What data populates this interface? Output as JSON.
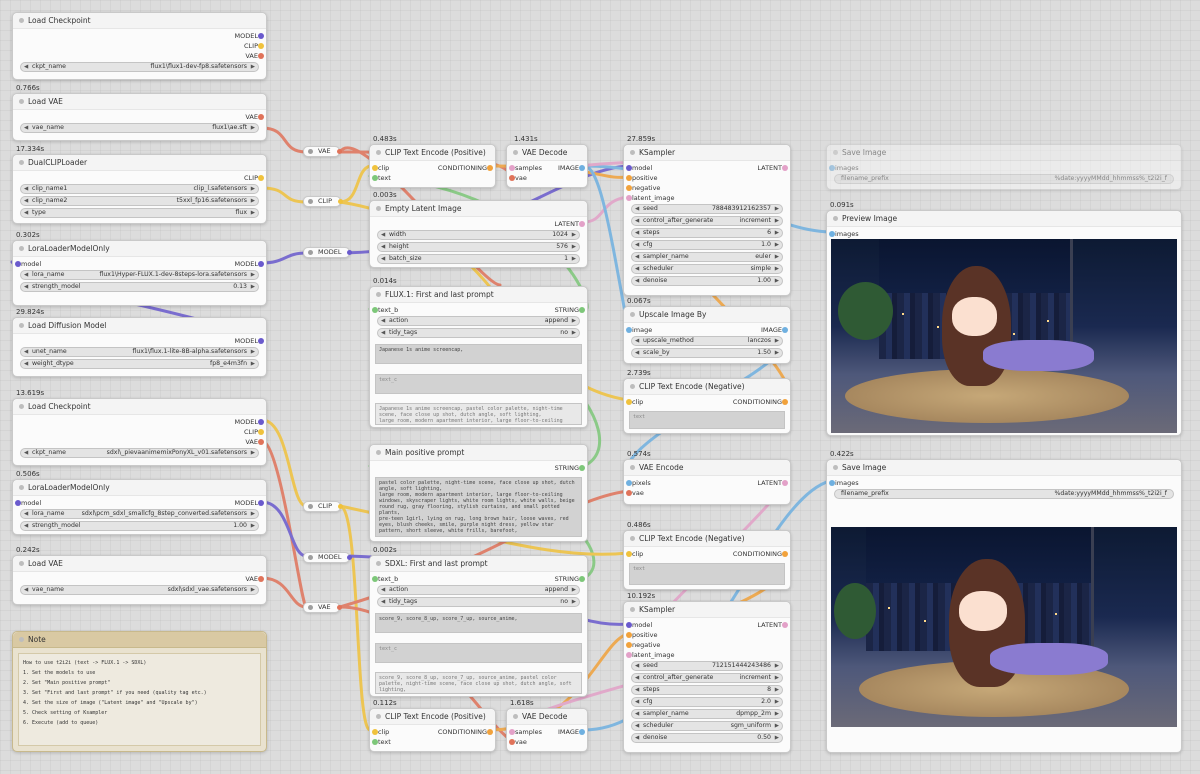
{
  "colors": {
    "model": "#6a5acd",
    "clip": "#f0c23c",
    "vae": "#e0735a",
    "conditioning": "#f1a23c",
    "latent": "#e3a1c8",
    "image": "#6fb0e0",
    "string": "#7dc779",
    "canvas": "#dcdcdc"
  },
  "nodes": {
    "load_checkpoint_1": {
      "title": "Load Checkpoint",
      "outputs": [
        "MODEL",
        "CLIP",
        "VAE"
      ],
      "ckpt_label": "ckpt_name",
      "ckpt_value": "flux1\\flux1-dev-fp8.safetensors"
    },
    "load_vae_1": {
      "timing": "0.766s",
      "title": "Load VAE",
      "output": "VAE",
      "label": "vae_name",
      "value": "flux1\\ae.sft"
    },
    "dual_clip": {
      "timing": "17.334s",
      "title": "DualCLIPLoader",
      "output": "CLIP",
      "clip1_label": "clip_name1",
      "clip1_value": "clip_l.safetensors",
      "clip2_label": "clip_name2",
      "clip2_value": "t5xxl_fp16.safetensors",
      "type_label": "type",
      "type_value": "flux"
    },
    "lora_flux": {
      "timing": "0.302s",
      "title": "LoraLoaderModelOnly",
      "input": "model",
      "output": "MODEL",
      "lora_label": "lora_name",
      "lora_value": "flux1\\Hyper-FLUX.1-dev-8steps-lora.safetensors",
      "strength_label": "strength_model",
      "strength_value": "0.13"
    },
    "load_diffusion": {
      "timing": "29.824s",
      "title": "Load Diffusion Model",
      "output": "MODEL",
      "unet_label": "unet_name",
      "unet_value": "flux1\\flux.1-lite-8B-alpha.safetensors",
      "dtype_label": "weight_dtype",
      "dtype_value": "fp8_e4m3fn"
    },
    "load_checkpoint_2": {
      "timing": "13.619s",
      "title": "Load Checkpoint",
      "outputs": [
        "MODEL",
        "CLIP",
        "VAE"
      ],
      "ckpt_label": "ckpt_name",
      "ckpt_value": "sdxl\\_pievaanimemixPonyXL_v01.safetensors"
    },
    "lora_sdxl": {
      "timing": "0.506s",
      "title": "LoraLoaderModelOnly",
      "input": "model",
      "output": "MODEL",
      "lora_label": "lora_name",
      "lora_value": "sdxl\\pcm_sdxl_smallcfg_8step_converted.safetensors",
      "strength_label": "strength_model",
      "strength_value": "1.00"
    },
    "load_vae_2": {
      "timing": "0.242s",
      "title": "Load VAE",
      "output": "VAE",
      "label": "vae_name",
      "value": "sdxl\\sdxl_vae.safetensors"
    },
    "note": {
      "title": "Note",
      "lines": [
        "How to use t2i2i (text -> FLUX.1 -> SDXL)",
        "1. Set the models to use",
        "2. Set \"Main positive prompt\"",
        "3. Set \"First and last prompt\" if you need (quality tag etc.)",
        "4. Set the size of image (\"Latent image\" and \"Upscale by\")",
        "5. Check setting of Ksampler",
        "6. Execute (add to queue)"
      ]
    },
    "clip_pos_1": {
      "timing": "0.483s",
      "title": "CLIP Text Encode (Positive)",
      "inputs": [
        "clip",
        "text"
      ],
      "output": "CONDITIONING"
    },
    "vae_decode_1": {
      "timing": "1.431s",
      "title": "VAE Decode",
      "inputs": [
        "samples",
        "vae"
      ],
      "output": "IMAGE"
    },
    "empty_latent": {
      "timing": "0.003s",
      "title": "Empty Latent Image",
      "output": "LATENT",
      "width_label": "width",
      "width_value": "1024",
      "height_label": "height",
      "height_value": "576",
      "batch_label": "batch_size",
      "batch_value": "1"
    },
    "flux_prompt": {
      "timing": "0.014s",
      "title": "FLUX.1: First and last prompt",
      "input": "text_b",
      "output": "STRING",
      "action_label": "action",
      "action_value": "append",
      "tidy_label": "tidy_tags",
      "tidy_value": "no",
      "text1": "Japanese 1s anime screencap,",
      "text2": "text_c",
      "preview": "Japanese 1s anime screencap, pastel color palette, night-time scene, face close up shot, dutch angle, soft lighting,\nlarge room, modern apartment interior, large floor-to-ceiling windows,\nskyscraper lights, white room lights, white walls, beige round rug"
    },
    "main_prompt": {
      "title": "Main positive prompt",
      "output": "STRING",
      "text": "pastel color palette, night-time scene, face close up shot, dutch angle, soft lighting,\nlarge room, modern apartment interior, large floor-to-ceiling windows, skyscraper lights, white room lights, white walls, beige round rug, gray flooring, stylish curtains, and small potted plants,\npre-teen 1girl, lying on rug, long brown hair, loose waves, red eyes, blush cheeks, smile, purple night dress, yellow star pattern, short sleeve, white frills, barefoot,"
    },
    "sdxl_prompt": {
      "timing": "0.002s",
      "title": "SDXL: First and last prompt",
      "input": "text_b",
      "output": "STRING",
      "action_label": "action",
      "action_value": "append",
      "tidy_label": "tidy_tags",
      "tidy_value": "no",
      "text1": "score_9, score_8_up, score_7_up, source_anime,",
      "text2": "text_c",
      "preview": "score_9, score_8_up, score_7_up, source_anime, pastel color palette, night-time scene, face close up shot, dutch angle, soft lighting,\nlarge room, modern apartment interior, large floor-to-ceiling windows,"
    },
    "clip_pos_2": {
      "timing": "0.112s",
      "title": "CLIP Text Encode (Positive)",
      "inputs": [
        "clip",
        "text"
      ],
      "output": "CONDITIONING"
    },
    "vae_decode_2": {
      "timing": "1.618s",
      "title": "VAE Decode",
      "inputs": [
        "samples",
        "vae"
      ],
      "output": "IMAGE"
    },
    "ksampler_1": {
      "timing": "27.859s",
      "title": "KSampler",
      "inputs": [
        "model",
        "positive",
        "negative",
        "latent_image"
      ],
      "output": "LATENT",
      "seed_label": "seed",
      "seed_value": "788483912162357",
      "control_label": "control_after_generate",
      "control_value": "increment",
      "steps_label": "steps",
      "steps_value": "6",
      "cfg_label": "cfg",
      "cfg_value": "1.0",
      "sampler_label": "sampler_name",
      "sampler_value": "euler",
      "scheduler_label": "scheduler",
      "scheduler_value": "simple",
      "denoise_label": "denoise",
      "denoise_value": "1.00"
    },
    "upscale": {
      "timing": "0.067s",
      "title": "Upscale Image By",
      "input": "image",
      "output": "IMAGE",
      "method_label": "upscale_method",
      "method_value": "lanczos",
      "scale_label": "scale_by",
      "scale_value": "1.50"
    },
    "clip_neg_1": {
      "timing": "2.739s",
      "title": "CLIP Text Encode (Negative)",
      "input": "clip",
      "output": "CONDITIONING",
      "text": "text"
    },
    "vae_encode": {
      "timing": "0.574s",
      "title": "VAE Encode",
      "inputs": [
        "pixels",
        "vae"
      ],
      "output": "LATENT"
    },
    "clip_neg_2": {
      "timing": "0.486s",
      "title": "CLIP Text Encode (Negative)",
      "input": "clip",
      "output": "CONDITIONING",
      "text": "text"
    },
    "ksampler_2": {
      "timing": "10.192s",
      "title": "KSampler",
      "inputs": [
        "model",
        "positive",
        "negative",
        "latent_image"
      ],
      "output": "LATENT",
      "seed_label": "seed",
      "seed_value": "712151444243486",
      "control_label": "control_after_generate",
      "control_value": "increment",
      "steps_label": "steps",
      "steps_value": "8",
      "cfg_label": "cfg",
      "cfg_value": "2.0",
      "sampler_label": "sampler_name",
      "sampler_value": "dpmpp_2m",
      "scheduler_label": "scheduler",
      "scheduler_value": "sgm_uniform",
      "denoise_label": "denoise",
      "denoise_value": "0.50"
    },
    "save_image_muted": {
      "title": "Save Image",
      "input": "images",
      "prefix_label": "filename_prefix",
      "prefix_value": "%date:yyyyMMdd_hhmmss%_t2i2i_f"
    },
    "preview_image": {
      "timing": "0.091s",
      "title": "Preview Image",
      "input": "images"
    },
    "save_image": {
      "timing": "0.422s",
      "title": "Save Image",
      "input": "images",
      "prefix_label": "filename_prefix",
      "prefix_value": "%date:yyyyMMdd_hhmmss%_t2i2i_f"
    }
  },
  "reroutes": {
    "vae1": "VAE",
    "clip1": "CLIP",
    "model1": "MODEL",
    "clip2": "CLIP",
    "model2": "MODEL",
    "vae2": "VAE"
  }
}
